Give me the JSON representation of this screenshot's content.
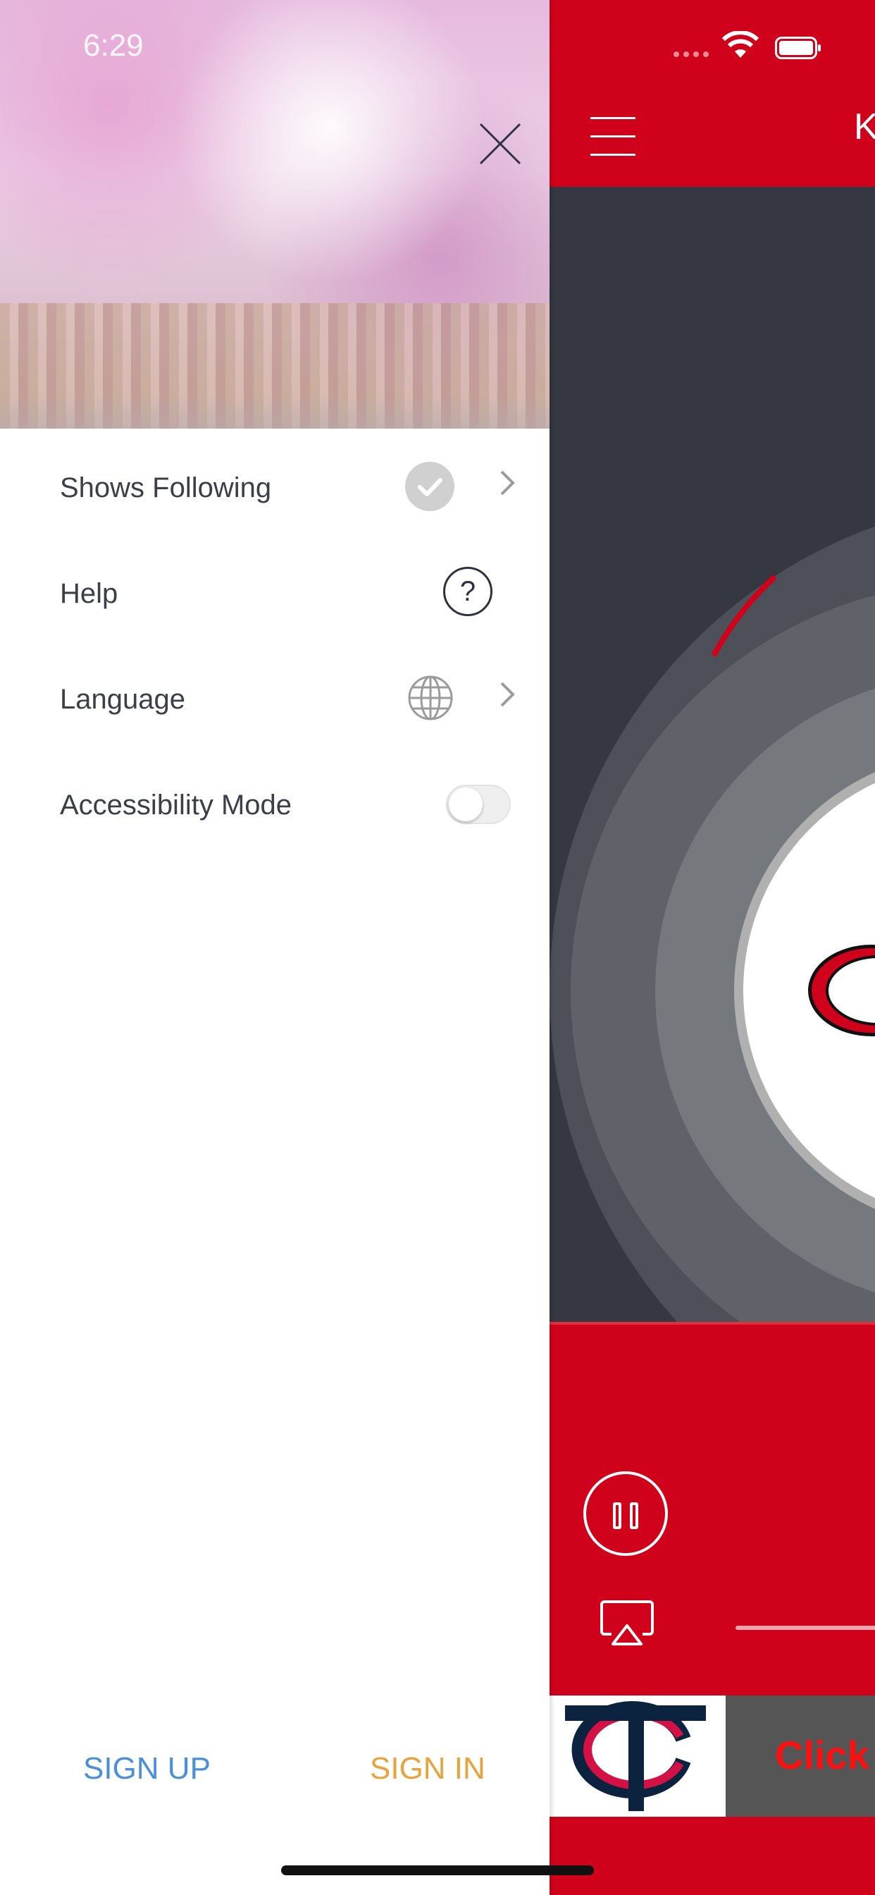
{
  "status_bar": {
    "time": "6:29"
  },
  "drawer": {
    "close_icon": "close-icon",
    "menu": [
      {
        "label": "Shows Following",
        "icon": "check-circle-icon",
        "has_chevron": true
      },
      {
        "label": "Help",
        "icon": "question-circle-icon",
        "has_chevron": false
      },
      {
        "label": "Language",
        "icon": "globe-icon",
        "has_chevron": true
      },
      {
        "label": "Accessibility Mode",
        "icon": "toggle",
        "toggle_on": false
      }
    ],
    "footer": {
      "sign_up": "SIGN UP",
      "sign_in": "SIGN IN"
    }
  },
  "background_app": {
    "title": "K",
    "banner_text": "Click",
    "colors": {
      "brand_red": "#d0021b",
      "dark_bg": "#353840"
    }
  },
  "colors": {
    "sign_up": "#4a90d9",
    "sign_in": "#e8a33d",
    "menu_text": "#3b3f4a"
  }
}
